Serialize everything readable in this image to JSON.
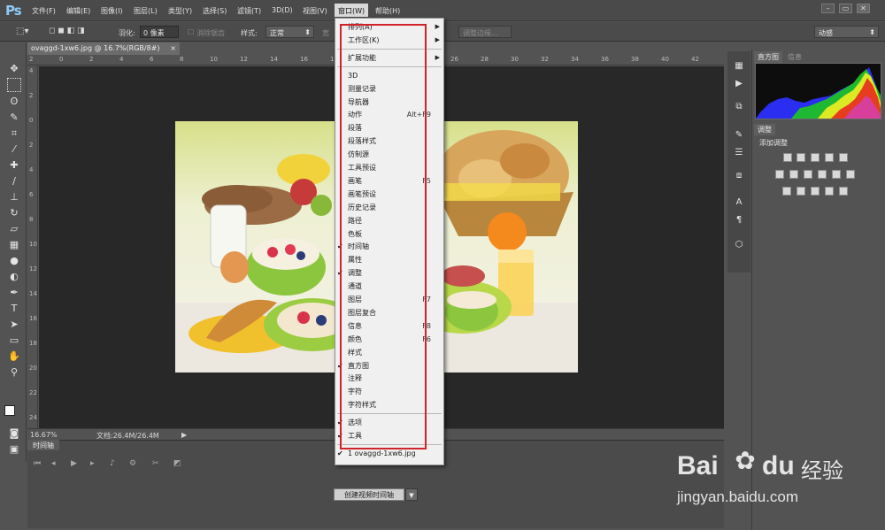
{
  "app": {
    "logo": "Ps"
  },
  "menubar": {
    "items": [
      "文件(F)",
      "编辑(E)",
      "图像(I)",
      "图层(L)",
      "类型(Y)",
      "选择(S)",
      "滤镜(T)",
      "3D(D)",
      "视图(V)",
      "窗口(W)",
      "帮助(H)"
    ],
    "open_item": "窗口(W)"
  },
  "options": {
    "feather_label": "羽化:",
    "feather_value": "0 像素",
    "antialias_label": "消除锯齿",
    "style_label": "样式:",
    "style_value": "正常",
    "width_label": "宽",
    "refine_edge": "调整边缘...",
    "workspace_value": "动感"
  },
  "document": {
    "tab": "ovaggd-1xw6.jpg @ 16.7%(RGB/8#)",
    "zoom": "16.67%",
    "doc_size": "文档:26.4M/26.4M"
  },
  "ruler": {
    "top": [
      "2",
      "0",
      "2",
      "4",
      "6",
      "8",
      "10",
      "12",
      "14",
      "16",
      "18",
      "20",
      "22",
      "24",
      "26",
      "28",
      "30",
      "32",
      "34",
      "36",
      "38",
      "40",
      "42"
    ],
    "left": [
      "4",
      "2",
      "0",
      "2",
      "4",
      "6",
      "8",
      "10",
      "12",
      "14",
      "16",
      "18",
      "20",
      "22",
      "24"
    ]
  },
  "timeline": {
    "tab": "时间轴",
    "create_video_button": "创建视频时间轴"
  },
  "panels": {
    "histogram_tab": "直方图",
    "info_tab": "信息",
    "adjustments_tab": "调整",
    "add_adjustment_label": "添加调整"
  },
  "window_menu": {
    "items": [
      {
        "label": "排列(A)",
        "submenu": true
      },
      {
        "label": "工作区(K)",
        "submenu": true
      },
      {
        "separator": true
      },
      {
        "label": "扩展功能",
        "submenu": true
      },
      {
        "separator": true
      },
      {
        "label": "3D"
      },
      {
        "label": "测量记录"
      },
      {
        "label": "导航器"
      },
      {
        "label": "动作",
        "shortcut": "Alt+F9"
      },
      {
        "label": "段落"
      },
      {
        "label": "段落样式"
      },
      {
        "label": "仿制源"
      },
      {
        "label": "工具预设"
      },
      {
        "label": "画笔",
        "shortcut": "F5"
      },
      {
        "label": "画笔预设"
      },
      {
        "label": "历史记录"
      },
      {
        "label": "路径"
      },
      {
        "label": "色板"
      },
      {
        "label": "时间轴",
        "checked": true
      },
      {
        "label": "属性"
      },
      {
        "label": "调整",
        "checked": true
      },
      {
        "label": "通道"
      },
      {
        "label": "图层",
        "shortcut": "F7"
      },
      {
        "label": "图层复合"
      },
      {
        "label": "信息",
        "shortcut": "F8"
      },
      {
        "label": "颜色",
        "shortcut": "F6"
      },
      {
        "label": "样式"
      },
      {
        "label": "直方图",
        "checked": true
      },
      {
        "label": "注释"
      },
      {
        "label": "字符"
      },
      {
        "label": "字符样式"
      },
      {
        "separator": true
      },
      {
        "label": "选项",
        "checked": true
      },
      {
        "label": "工具",
        "checked": true
      },
      {
        "separator": true
      },
      {
        "label": "1 ovaggd-1xw6.jpg",
        "checked": true
      }
    ]
  },
  "watermark": {
    "brand": "Bai",
    "brand_suffix": "du",
    "product": "经验",
    "url": "jingyan.baidu.com"
  },
  "colors": {
    "menu_highlight": "#d2232a",
    "ps_blue": "#8ec9f7"
  }
}
